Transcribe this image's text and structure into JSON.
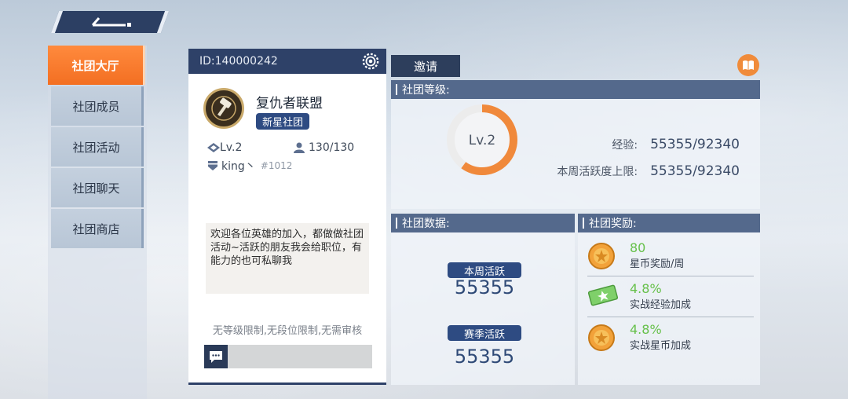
{
  "nav": {
    "items": [
      {
        "label": "社团大厅",
        "active": true
      },
      {
        "label": "社团成员",
        "active": false
      },
      {
        "label": "社团活动",
        "active": false
      },
      {
        "label": "社团聊天",
        "active": false
      },
      {
        "label": "社团商店",
        "active": false
      }
    ]
  },
  "club": {
    "id_text": "ID:140000242",
    "name": "复仇者联盟",
    "tag": "新星社团",
    "level": "Lv.2",
    "members": "130/130",
    "owner": "king丶",
    "owner_tag": "#1012",
    "notice": "欢迎各位英雄的加入，都做做社团活动~活跃的朋友我会给职位，有能力的也可私聊我",
    "limits": "无等级限制,无段位限制,无需审核"
  },
  "actions": {
    "invite": "邀请"
  },
  "level_panel": {
    "title": "社团等级:",
    "level": "Lv.2",
    "exp_label": "经验:",
    "exp_value": "55355/92340",
    "week_label": "本周活跃度上限:",
    "week_value": "55355/92340",
    "progress": 0.6,
    "ring_color": "#f0893b"
  },
  "data_panel": {
    "title": "社团数据:",
    "week_label": "本周活跃",
    "week_value": "55355",
    "season_label": "赛季活跃",
    "season_value": "55355"
  },
  "reward_panel": {
    "title": "社团奖励:",
    "items": [
      {
        "value": "80",
        "label": "星币奖励/周",
        "icon": "star-coin-icon"
      },
      {
        "value": "4.8%",
        "label": "实战经验加成",
        "icon": "exp-ticket-icon"
      },
      {
        "value": "4.8%",
        "label": "实战星币加成",
        "icon": "star-coin-icon"
      }
    ]
  },
  "colors": {
    "accent": "#f36f22",
    "navy": "#2e4168",
    "green_value": "#66c04a"
  }
}
